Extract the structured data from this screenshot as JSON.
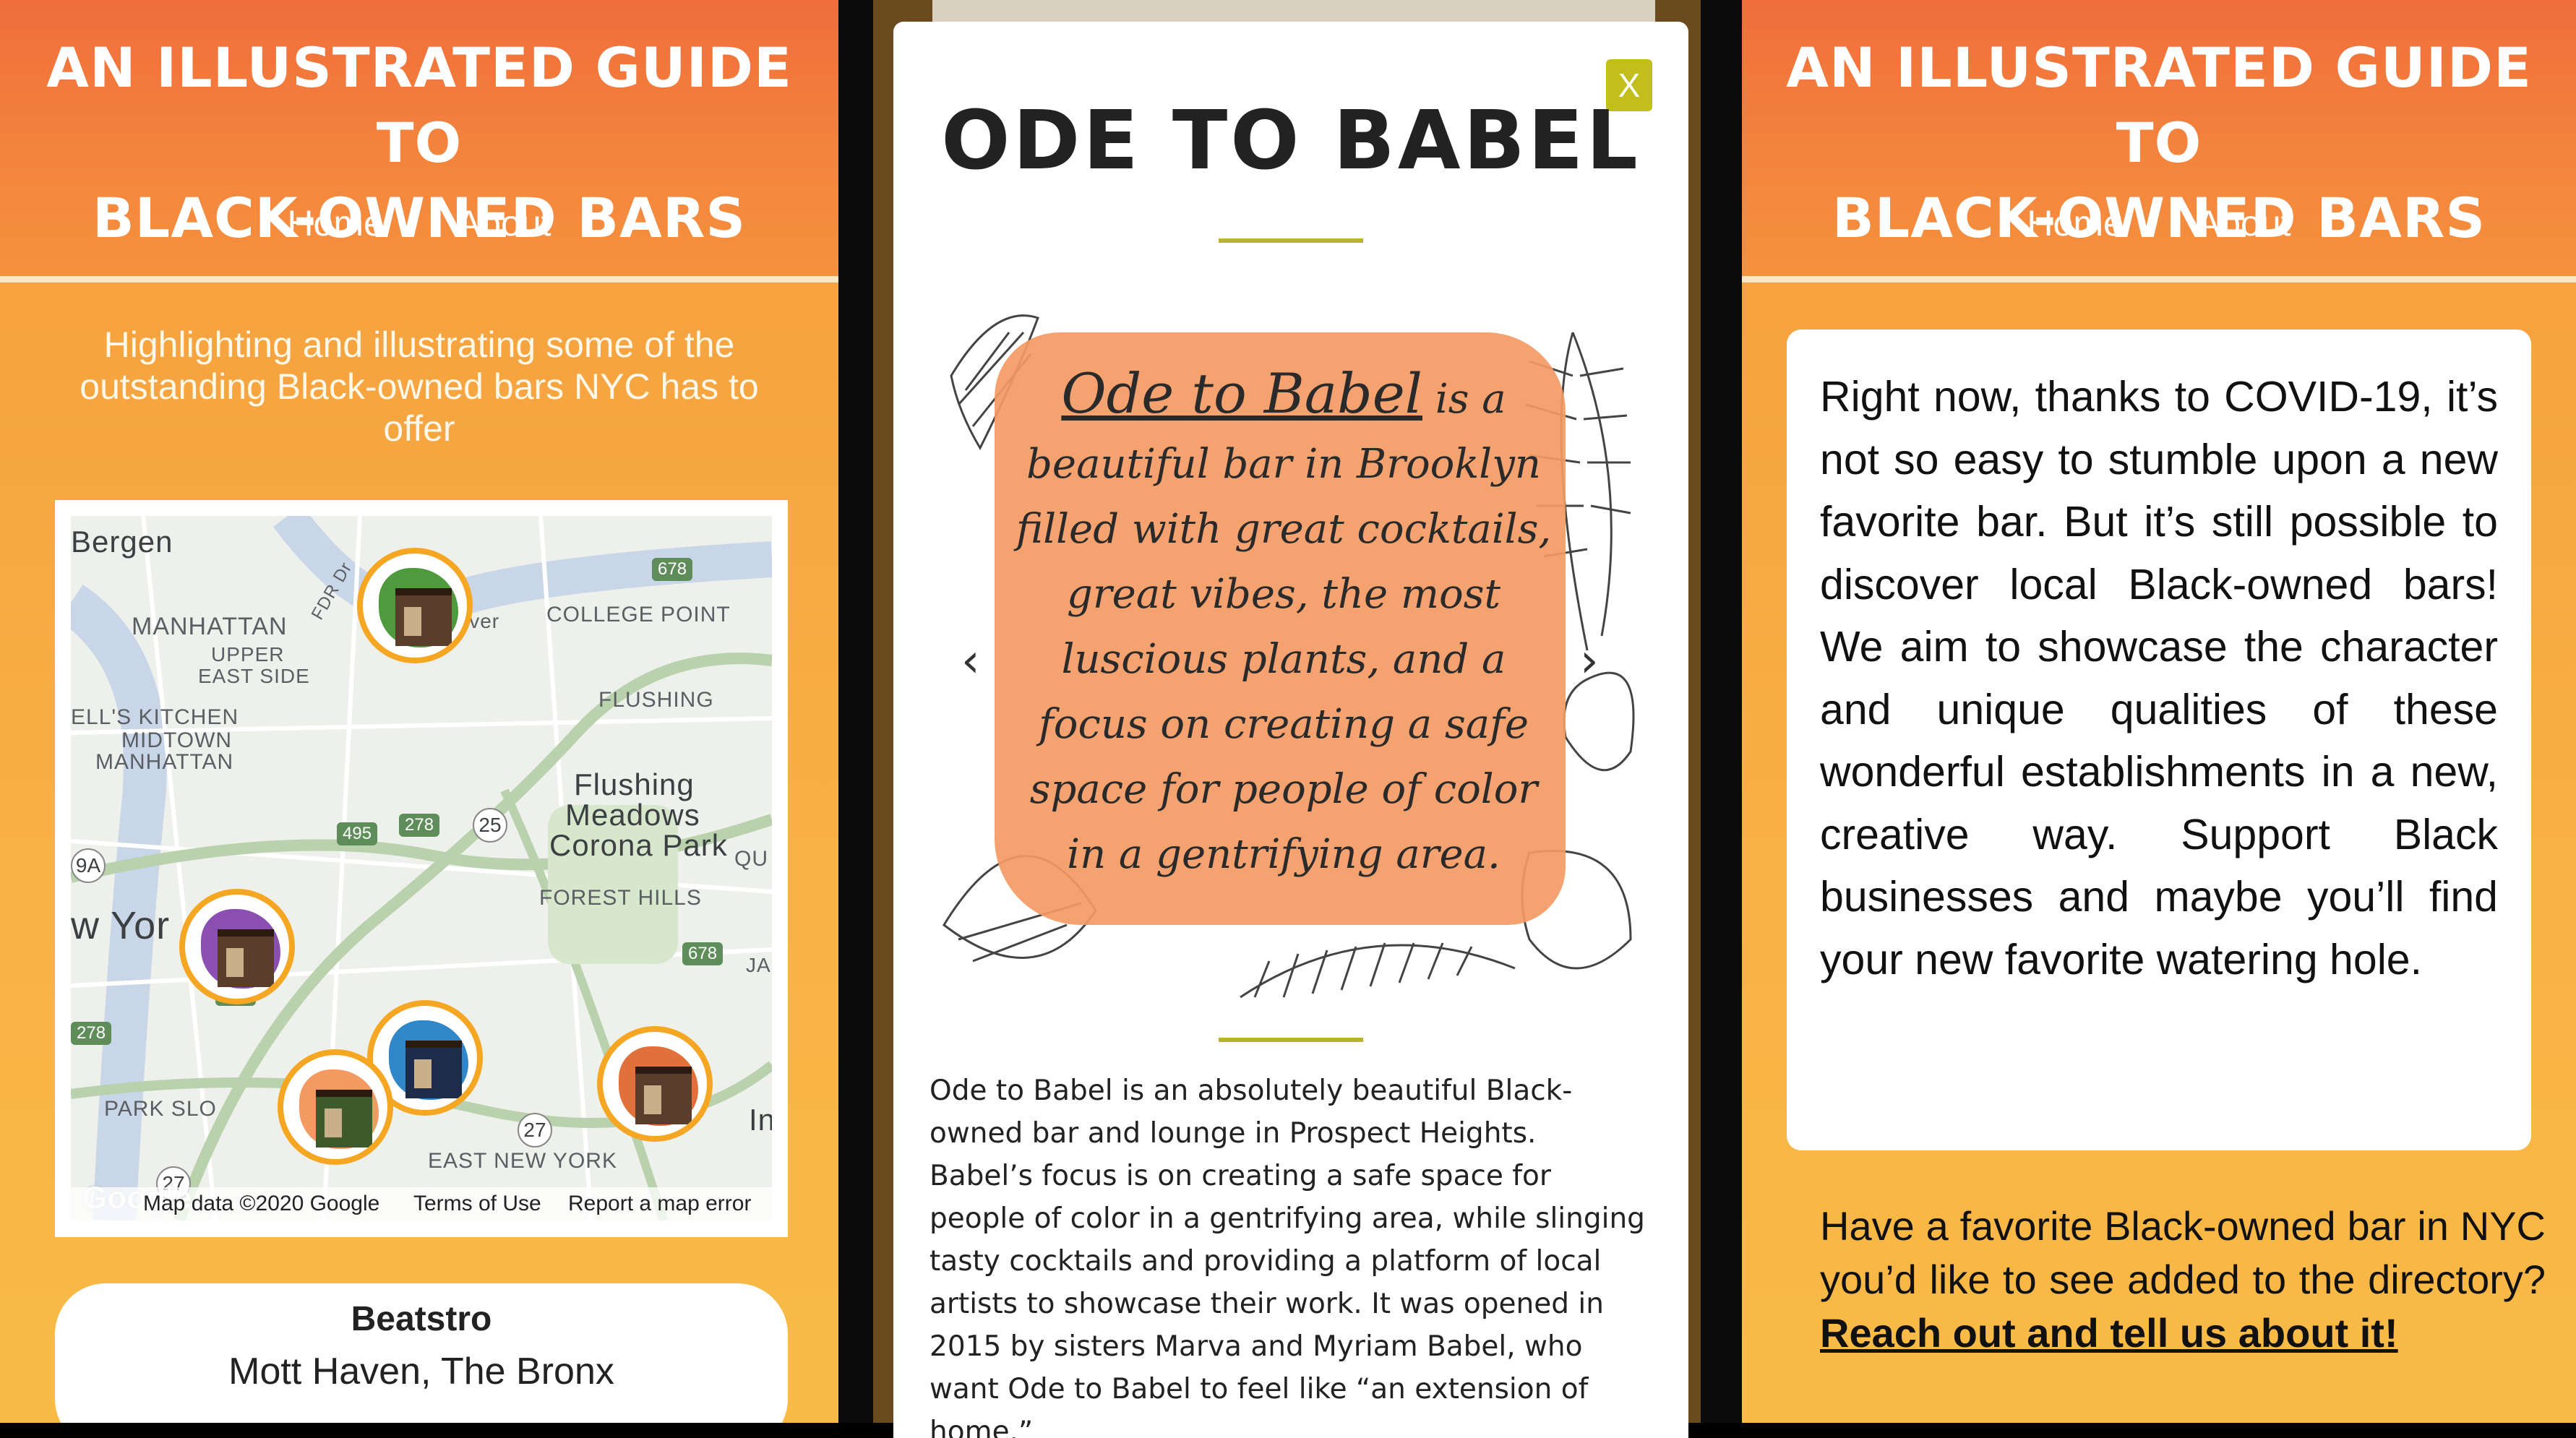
{
  "site": {
    "title_line1": "AN ILLUSTRATED GUIDE TO",
    "title_line2": "BLACK-OWNED BARS",
    "nav": [
      "Home",
      "About"
    ]
  },
  "left_panel": {
    "tagline": "Highlighting and illustrating some of the outstanding Black-owned bars NYC has to offer",
    "map": {
      "labels": [
        "Bergen",
        "MANHATTAN",
        "UPPER",
        "EAST SIDE",
        "ELL'S KITCHEN",
        "MIDTOWN",
        "MANHATTAN",
        "COLLEGE POINT",
        "FLUSHING",
        "Flushing",
        "Meadows",
        "Corona Park",
        "FOREST HILLS",
        "QU",
        "w Yor",
        "PARK SLO",
        "EAST NEW YORK",
        "In",
        "FDR Dr",
        "iver",
        "JA"
      ],
      "routes": [
        "678",
        "278",
        "495",
        "25",
        "678",
        "278",
        "9A",
        "278",
        "27",
        "27"
      ],
      "attribution": "Map data ©2020 Google",
      "terms": "Terms of Use",
      "report": "Report a map error",
      "google_logo": "Google"
    },
    "selected_bar": {
      "name": "Beatstro",
      "location": "Mott Haven, The Bronx"
    }
  },
  "modal": {
    "title": "ODE TO BABEL",
    "close_label": "X",
    "illustration_text": {
      "name": "Ode to Babel",
      "lines": [
        "is a",
        "beautiful bar in Brooklyn",
        "filled with great cocktails,",
        "great vibes, the most",
        "luscious plants, and a",
        "focus on creating a safe",
        "space for people of color",
        "in a gentrifying area."
      ]
    },
    "prev_arrow": "‹",
    "next_arrow": "›",
    "description": "Ode to Babel is an absolutely beautiful Black-owned bar and lounge in Prospect Heights. Babel’s focus is on creating a safe space for people of color in a gentrifying area, while slinging tasty cocktails and providing a platform of local artists to showcase their work. It was opened in 2015 by sisters Marva and Myriam Babel, who want Ode to Babel to feel like “an extension of home.”"
  },
  "right_panel": {
    "about_text": "Right now, thanks to COVID-19, it’s not so easy to stumble upon a new favorite bar. But it’s still possible to discover local Black-owned bars! We aim to showcase the character and unique qualities of these wonderful establishments in a new, creative way. Support Black businesses and maybe you’ll find your new favorite watering hole.",
    "cta_text": "Have a favorite Black-owned bar in NYC you’d like to see added to the directory?",
    "cta_link": "Reach out and tell us about it!"
  },
  "colors": {
    "header_orange": "#f06d3b",
    "body_orange": "#f8b143",
    "olive": "#c2bf1c",
    "pin_ring": "#f5a623"
  }
}
